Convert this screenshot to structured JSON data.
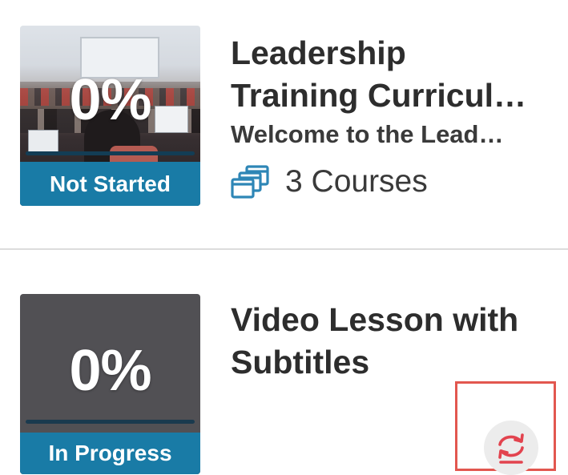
{
  "items": [
    {
      "percent": "0%",
      "progress": 0,
      "status": "Not Started",
      "title_line1": "Leadership",
      "title_line2": "Training Curricul…",
      "subtitle": "Welcome to the Lead…",
      "courses_label": "3 Courses",
      "thumbnail": "classroom-photo"
    },
    {
      "percent": "0%",
      "progress": 0,
      "status": "In Progress",
      "title_line1": "Video Lesson with",
      "title_line2": "Subtitles",
      "thumbnail": "gray-placeholder"
    }
  ],
  "icons": {
    "courses": "stacked-windows-icon",
    "sync": "sync-icon"
  },
  "colors": {
    "status_bar": "#197ba6",
    "accent_red": "#e2574f",
    "title_text": "#2d2d2d"
  }
}
